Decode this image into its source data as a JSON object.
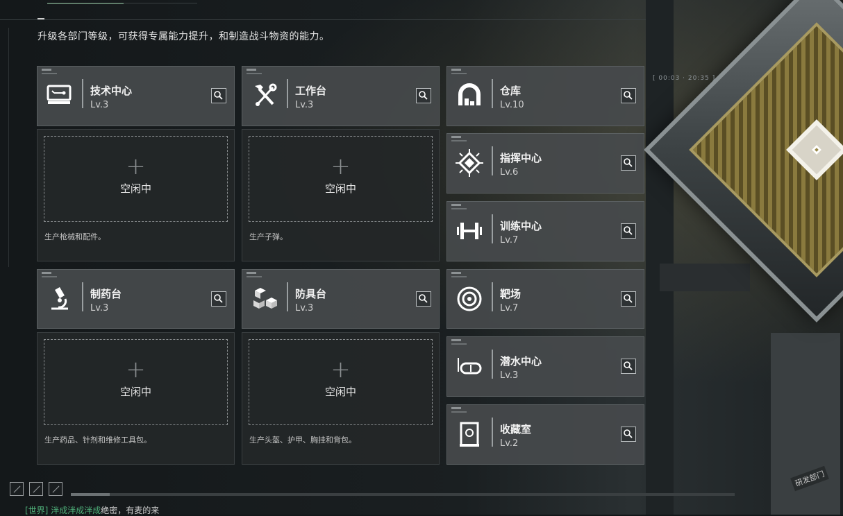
{
  "description": "升级各部门等级，可获得专属能力提升，和制造战斗物资的能力。",
  "colors": {
    "accent_green": "#4fb07a",
    "card_bg": "#464a4c",
    "slot_bg": "#242728"
  },
  "left_cards": [
    {
      "title": "技术中心",
      "level": "Lv.3",
      "icon": "computer-terminal-icon",
      "slot_status": "空闲中",
      "slot_note": "生产枪械和配件。"
    },
    {
      "title": "工作台",
      "level": "Lv.3",
      "icon": "hammer-wrench-icon",
      "slot_status": "空闲中",
      "slot_note": "生产子弹。"
    },
    {
      "title": "制药台",
      "level": "Lv.3",
      "icon": "microscope-icon",
      "slot_status": "空闲中",
      "slot_note": "生产药品、针剂和维修工具包。"
    },
    {
      "title": "防具台",
      "level": "Lv.3",
      "icon": "cubes-icon",
      "slot_status": "空闲中",
      "slot_note": "生产头盔、护甲、胸挂和背包。"
    }
  ],
  "right_cards": [
    {
      "title": "仓库",
      "level": "Lv.10",
      "icon": "warehouse-icon"
    },
    {
      "title": "指挥中心",
      "level": "Lv.6",
      "icon": "chip-icon"
    },
    {
      "title": "训练中心",
      "level": "Lv.7",
      "icon": "dumbbell-icon"
    },
    {
      "title": "靶场",
      "level": "Lv.7",
      "icon": "target-icon"
    },
    {
      "title": "潜水中心",
      "level": "Lv.3",
      "icon": "diving-mask-icon"
    },
    {
      "title": "收藏室",
      "level": "Lv.2",
      "icon": "display-case-icon"
    }
  ],
  "hud_code": "[ 00:03 · 20:35 ]",
  "scene_sign": "研发部门",
  "chat": {
    "channel": "[世界]",
    "sender": "泮成泮成泮成",
    "message": "绝密，有麦的来"
  }
}
